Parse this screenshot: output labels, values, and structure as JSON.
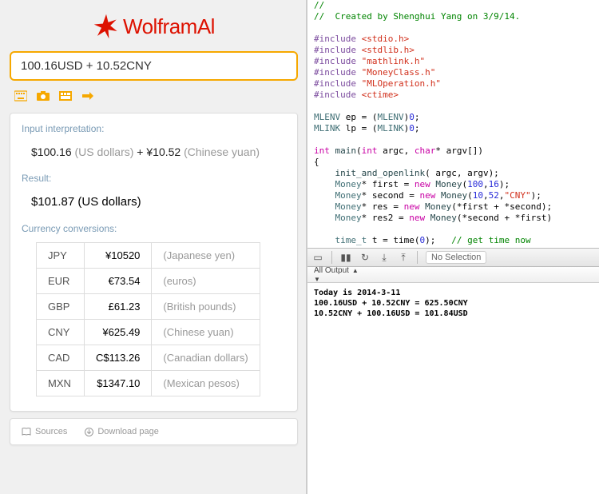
{
  "wolfram": {
    "logo_text": "WolframAl",
    "query": "100.16USD + 10.52CNY",
    "sections": {
      "interpretation": {
        "title": "Input interpretation:",
        "amount1": "$100.16",
        "unit1": "(US dollars)",
        "plus": "+",
        "amount2": "¥10.52",
        "unit2": "(Chinese yuan)"
      },
      "result": {
        "title": "Result:",
        "amount": "$101.87",
        "unit": "(US dollars)"
      },
      "conversions": {
        "title": "Currency conversions:",
        "rows": [
          {
            "code": "JPY",
            "value": "¥10520",
            "unit": "(Japanese yen)"
          },
          {
            "code": "EUR",
            "value": "€73.54",
            "unit": "(euros)"
          },
          {
            "code": "GBP",
            "value": "£61.23",
            "unit": "(British pounds)"
          },
          {
            "code": "CNY",
            "value": "¥625.49",
            "unit": "(Chinese yuan)"
          },
          {
            "code": "CAD",
            "value": "C$113.26",
            "unit": "(Canadian dollars)"
          },
          {
            "code": "MXN",
            "value": "$1347.10",
            "unit": "(Mexican pesos)"
          }
        ]
      }
    },
    "footer": {
      "sources": "Sources",
      "download": "Download page"
    }
  },
  "xcode": {
    "code_comment_author": "//  Created by Shenghui Yang on 3/9/14.",
    "debug": {
      "no_selection": "No Selection",
      "filter": "All Output"
    },
    "console_lines": [
      "Today is 2014-3-11",
      "100.16USD + 10.52CNY = 625.50CNY",
      "10.52CNY + 100.16USD = 101.84USD"
    ]
  }
}
